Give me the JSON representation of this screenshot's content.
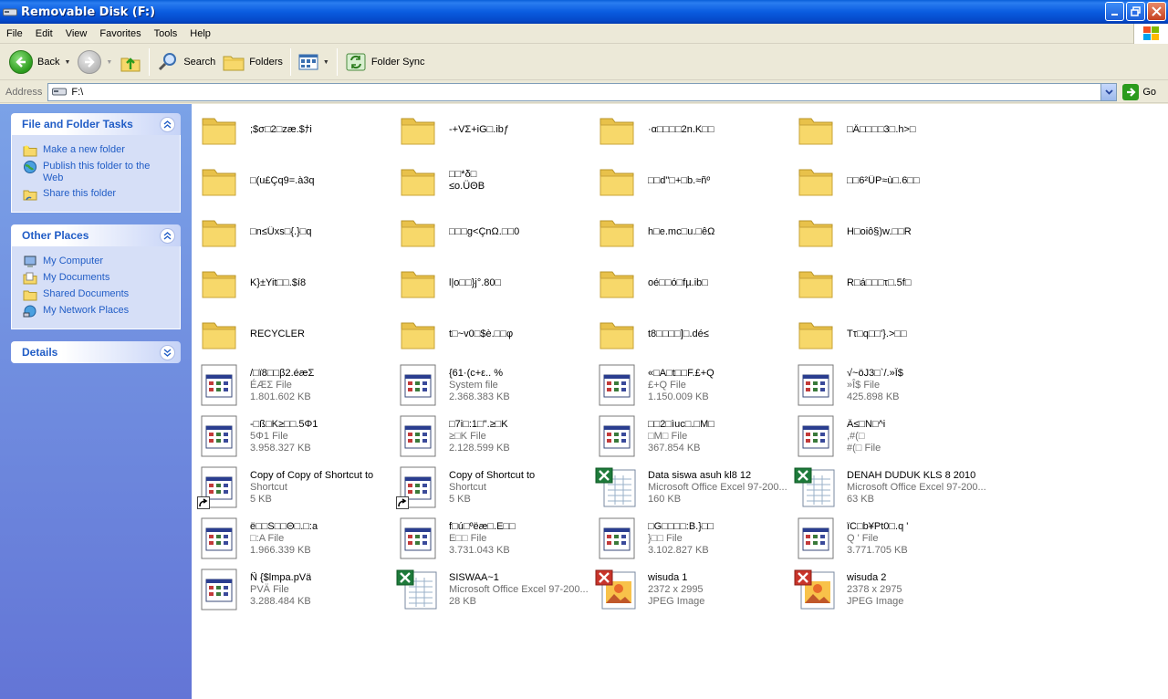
{
  "window": {
    "title": "Removable Disk (F:)"
  },
  "menu": [
    "File",
    "Edit",
    "View",
    "Favorites",
    "Tools",
    "Help"
  ],
  "toolbar": {
    "back": "Back",
    "search": "Search",
    "folders": "Folders",
    "folder_sync": "Folder Sync"
  },
  "address": {
    "label": "Address",
    "value": "F:\\",
    "go": "Go"
  },
  "tasks": {
    "file_folder": {
      "title": "File and Folder Tasks",
      "items": [
        "Make a new folder",
        "Publish this folder to the Web",
        "Share this folder"
      ]
    },
    "other_places": {
      "title": "Other Places",
      "items": [
        "My Computer",
        "My Documents",
        "Shared Documents",
        "My Network Places"
      ]
    },
    "details": {
      "title": "Details"
    }
  },
  "items": [
    {
      "kind": "folder",
      "name": ";$σ□2□zæ.$ﾅi",
      "l2": "",
      "l3": ""
    },
    {
      "kind": "folder",
      "name": "-+VΣ+iG□.ibƒ",
      "l2": "",
      "l3": ""
    },
    {
      "kind": "folder",
      "name": "·α□□□□2n.K□□",
      "l2": "",
      "l3": ""
    },
    {
      "kind": "folder",
      "name": "□Ä□□□□3□.h>□",
      "l2": "",
      "l3": ""
    },
    {
      "kind": "folder",
      "name": "□(u£Çq9=.à3q",
      "l2": "",
      "l3": ""
    },
    {
      "kind": "folder",
      "name": "□□*δ□",
      "l2": "≤o.ÜΘB",
      "l3": ""
    },
    {
      "kind": "folder",
      "name": "□□d\"□+□b.≈ñº",
      "l2": "",
      "l3": ""
    },
    {
      "kind": "folder",
      "name": "□□6²ÜP≈ù□.6□□",
      "l2": "",
      "l3": ""
    },
    {
      "kind": "folder",
      "name": "□n≤Üxs□{.}□q",
      "l2": "",
      "l3": ""
    },
    {
      "kind": "folder",
      "name": "□□□g<ÇnΩ.□□0",
      "l2": "",
      "l3": ""
    },
    {
      "kind": "folder",
      "name": "h□e.mc□u.□êΩ",
      "l2": "",
      "l3": ""
    },
    {
      "kind": "folder",
      "name": "H□oiô§)w.□□R",
      "l2": "",
      "l3": ""
    },
    {
      "kind": "folder",
      "name": "K}±Yit□□.$í8",
      "l2": "",
      "l3": ""
    },
    {
      "kind": "folder",
      "name": "l|o□□}j°.80□",
      "l2": "",
      "l3": ""
    },
    {
      "kind": "folder",
      "name": "oé□□ó□fµ.ib□",
      "l2": "",
      "l3": ""
    },
    {
      "kind": "folder",
      "name": "R□á□□□τ□.5f□",
      "l2": "",
      "l3": ""
    },
    {
      "kind": "folder",
      "name": "RECYCLER",
      "l2": "",
      "l3": ""
    },
    {
      "kind": "folder",
      "name": "t□~v0□$è.□□φ",
      "l2": "",
      "l3": ""
    },
    {
      "kind": "folder",
      "name": "t8□□□□]□.dé≤",
      "l2": "",
      "l3": ""
    },
    {
      "kind": "folder",
      "name": "Tτ□q□□'}.>□□",
      "l2": "",
      "l3": ""
    },
    {
      "kind": "app",
      "name": "/□ï8□□β2.éæΣ",
      "l2": "ÉÆΣ File",
      "l3": "1.801.602 KB"
    },
    {
      "kind": "app",
      "name": "{61·(c+ε.. %",
      "l2": "System file",
      "l3": "2.368.383 KB"
    },
    {
      "kind": "app",
      "name": "«□A□t□□F.£+Q",
      "l2": "£+Q File",
      "l3": "1.150.009 KB"
    },
    {
      "kind": "app",
      "name": "√~öJ3□`/.»Î$",
      "l2": "»Î$ File",
      "l3": "425.898 KB"
    },
    {
      "kind": "app",
      "name": "-□ß□K≥□□.5Φ1",
      "l2": "5Φ1 File",
      "l3": "3.958.327 KB"
    },
    {
      "kind": "app",
      "name": "□7i□:1□\".≥□K",
      "l2": "≥□K File",
      "l3": "2.128.599 KB"
    },
    {
      "kind": "app",
      "name": "□□2□ìuc□.□M□",
      "l2": "□M□ File",
      "l3": "367.854 KB"
    },
    {
      "kind": "app",
      "name": "Ä≤□N□^i",
      "l2": ",#(□",
      "l3": "#(□ File"
    },
    {
      "kind": "shortcut",
      "name": "Copy of Copy of Shortcut to",
      "l2": "Shortcut",
      "l3": "5 KB"
    },
    {
      "kind": "shortcut",
      "name": "Copy of Shortcut to",
      "l2": "Shortcut",
      "l3": "5 KB"
    },
    {
      "kind": "excel",
      "name": "Data siswa asuh kl8 12",
      "l2": "Microsoft Office Excel 97-200...",
      "l3": "160 KB"
    },
    {
      "kind": "excel",
      "name": "DENAH DUDUK KLS 8 2010",
      "l2": "Microsoft Office Excel 97-200...",
      "l3": "63 KB"
    },
    {
      "kind": "app",
      "name": "ë□□S□□Θ□.□:a",
      "l2": "□:A File",
      "l3": "1.966.339 KB"
    },
    {
      "kind": "app",
      "name": "f□ú□ºëæ□.E□□",
      "l2": "E□□ File",
      "l3": "3.731.043 KB"
    },
    {
      "kind": "app",
      "name": "□G□□□□:B.}□□",
      "l2": "}□□ File",
      "l3": "3.102.827 KB"
    },
    {
      "kind": "app",
      "name": "ïC□b¥Pt0□.q '",
      "l2": "Q ' File",
      "l3": "3.771.705 KB"
    },
    {
      "kind": "app",
      "name": "Ñ {$lmpa.pVä",
      "l2": "PVÄ File",
      "l3": "3.288.484 KB"
    },
    {
      "kind": "excel",
      "name": "SISWAA~1",
      "l2": "Microsoft Office Excel 97-200...",
      "l3": "28 KB"
    },
    {
      "kind": "jpeg",
      "name": "wisuda 1",
      "l2": "2372 x 2995",
      "l3": "JPEG Image"
    },
    {
      "kind": "jpeg",
      "name": "wisuda 2",
      "l2": "2378 x 2975",
      "l3": "JPEG Image"
    }
  ],
  "colors": {
    "title_bar": "#0a5ce0",
    "task_pane": "#6f8de0",
    "link": "#215dc6",
    "folder": "#f7d86a"
  }
}
